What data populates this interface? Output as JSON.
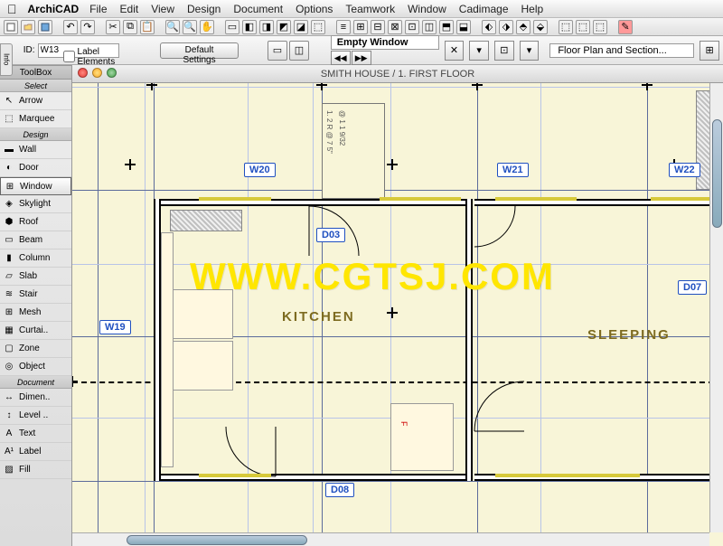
{
  "menubar": {
    "appname": "ArchiCAD",
    "items": [
      "File",
      "Edit",
      "View",
      "Design",
      "Document",
      "Options",
      "Teamwork",
      "Window",
      "Cadimage",
      "Help"
    ]
  },
  "options_row": {
    "id_label": "ID:",
    "id_value": "W13",
    "checkbox_label": "Label Elements",
    "settings_button": "Default Settings",
    "title_label": "Empty Window",
    "navigator_label": "Floor Plan and Section..."
  },
  "toolbox": {
    "title": "ToolBox",
    "sections": {
      "select": "Select",
      "design": "Design",
      "document": "Document"
    },
    "select_tools": [
      {
        "icon": "arrow-icon",
        "label": "Arrow"
      },
      {
        "icon": "marquee-icon",
        "label": "Marquee"
      }
    ],
    "design_tools": [
      {
        "icon": "wall-icon",
        "label": "Wall"
      },
      {
        "icon": "door-icon",
        "label": "Door"
      },
      {
        "icon": "window-icon",
        "label": "Window",
        "active": true
      },
      {
        "icon": "skylight-icon",
        "label": "Skylight"
      },
      {
        "icon": "roof-icon",
        "label": "Roof"
      },
      {
        "icon": "beam-icon",
        "label": "Beam"
      },
      {
        "icon": "column-icon",
        "label": "Column"
      },
      {
        "icon": "slab-icon",
        "label": "Slab"
      },
      {
        "icon": "stair-icon",
        "label": "Stair"
      },
      {
        "icon": "mesh-icon",
        "label": "Mesh"
      },
      {
        "icon": "curtain-icon",
        "label": "Curtai.."
      },
      {
        "icon": "zone-icon",
        "label": "Zone"
      },
      {
        "icon": "object-icon",
        "label": "Object"
      }
    ],
    "document_tools": [
      {
        "icon": "dimension-icon",
        "label": "Dimen.."
      },
      {
        "icon": "level-icon",
        "label": "Level .."
      },
      {
        "icon": "text-icon",
        "label": "Text"
      },
      {
        "icon": "label-icon",
        "label": "Label"
      },
      {
        "icon": "fill-icon",
        "label": "Fill"
      }
    ]
  },
  "canvas": {
    "window_title": "SMITH HOUSE / 1. FIRST FLOOR",
    "rooms": {
      "kitchen": "KITCHEN",
      "sleeping": "SLEEPING"
    },
    "tags": {
      "w19": "W19",
      "w20": "W20",
      "w21": "W21",
      "w22": "W22",
      "d03": "D03",
      "d07": "D07",
      "d08": "D08"
    },
    "stair_text1": "1. 2 R @ 7 5\"",
    "stair_text2": "@ 1 1 9/32",
    "red_letter": "F"
  },
  "watermark": "WWW.CGTSJ.COM",
  "info_tab": "Info"
}
